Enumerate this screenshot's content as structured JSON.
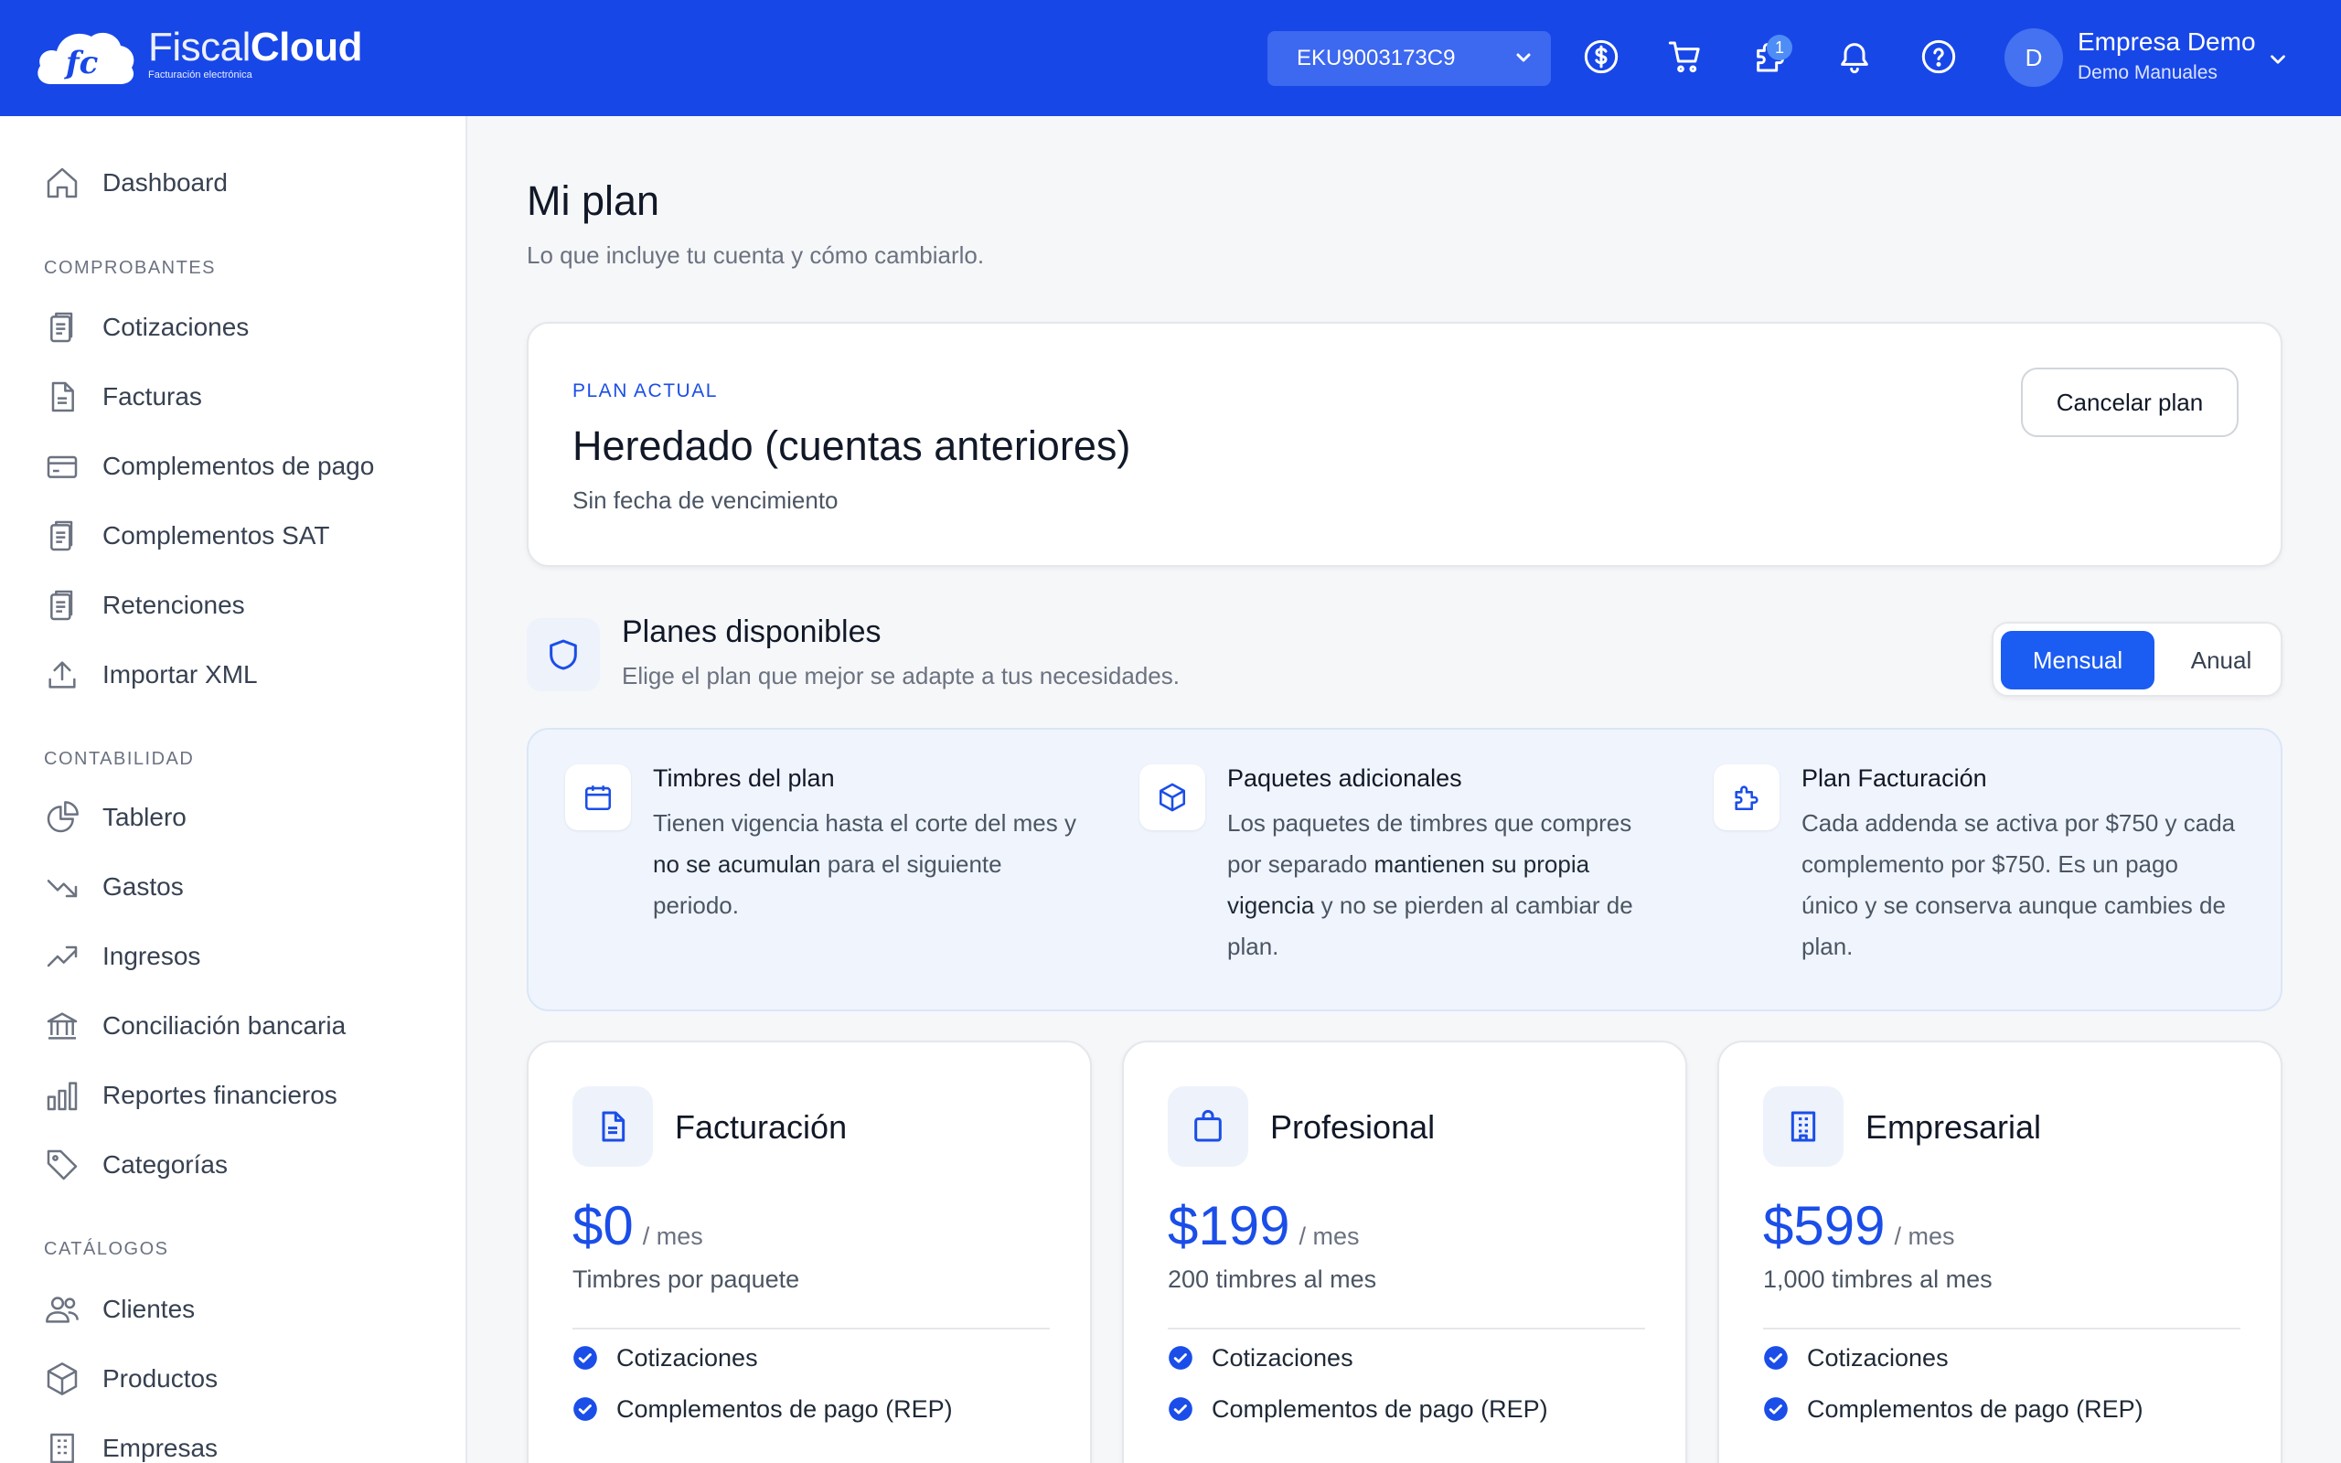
{
  "header": {
    "logo": {
      "brand_light": "Fiscal",
      "brand_bold": "Cloud",
      "tagline": "Facturación electrónica",
      "monogram": "fc"
    },
    "rfc_select": {
      "value": "EKU9003173C9"
    },
    "notification_badge": "1",
    "icons": [
      "dollar-icon",
      "cart-icon",
      "puzzle-icon",
      "bell-icon",
      "help-icon"
    ],
    "user": {
      "initial": "D",
      "name": "Empresa Demo",
      "subtitle": "Demo Manuales"
    }
  },
  "sidebar": {
    "dashboard": "Dashboard",
    "sections": {
      "comprobantes": "COMPROBANTES",
      "contabilidad": "CONTABILIDAD",
      "catalogos": "CATÁLOGOS"
    },
    "comprobantes": [
      "Cotizaciones",
      "Facturas",
      "Complementos de pago",
      "Complementos SAT",
      "Retenciones",
      "Importar XML"
    ],
    "contabilidad": [
      "Tablero",
      "Gastos",
      "Ingresos",
      "Conciliación bancaria",
      "Reportes financieros",
      "Categorías"
    ],
    "catalogos": [
      "Clientes",
      "Productos",
      "Empresas"
    ]
  },
  "page": {
    "title": "Mi plan",
    "subtitle": "Lo que incluye tu cuenta y cómo cambiarlo."
  },
  "current_plan": {
    "label": "PLAN ACTUAL",
    "name": "Heredado (cuentas anteriores)",
    "expiration": "Sin fecha de vencimiento",
    "cancel_label": "Cancelar plan"
  },
  "available": {
    "title": "Planes disponibles",
    "subtitle": "Elige el plan que mejor se adapte a tus necesidades.",
    "toggle": {
      "monthly": "Mensual",
      "yearly": "Anual",
      "selected": "Mensual"
    }
  },
  "info": [
    {
      "title": "Timbres del plan",
      "p1": "Tienen vigencia hasta el corte del mes y ",
      "b1": "no se acumulan",
      "p2": " para el siguiente periodo."
    },
    {
      "title": "Paquetes adicionales",
      "p1": "Los paquetes de timbres que compres por separado ",
      "b1": "mantienen su propia vigencia",
      "p2": " y no se pierden al cambiar de plan."
    },
    {
      "title": "Plan Facturación",
      "p1": "Cada addenda se activa por $750 y cada complemento por $750. Es un pago único y se conserva aunque cambies de plan.",
      "b1": "",
      "p2": ""
    }
  ],
  "plans": [
    {
      "name": "Facturación",
      "price": "$0",
      "period": "/ mes",
      "desc": "Timbres por paquete",
      "features": [
        "Cotizaciones",
        "Complementos de pago (REP)"
      ]
    },
    {
      "name": "Profesional",
      "price": "$199",
      "period": "/ mes",
      "desc": "200 timbres al mes",
      "features": [
        "Cotizaciones",
        "Complementos de pago (REP)"
      ]
    },
    {
      "name": "Empresarial",
      "price": "$599",
      "period": "/ mes",
      "desc": "1,000 timbres al mes",
      "features": [
        "Cotizaciones",
        "Complementos de pago (REP)"
      ]
    }
  ],
  "colors": {
    "header": "#1847e8",
    "accent": "#1b5cf2",
    "price": "#1b4ee8"
  }
}
